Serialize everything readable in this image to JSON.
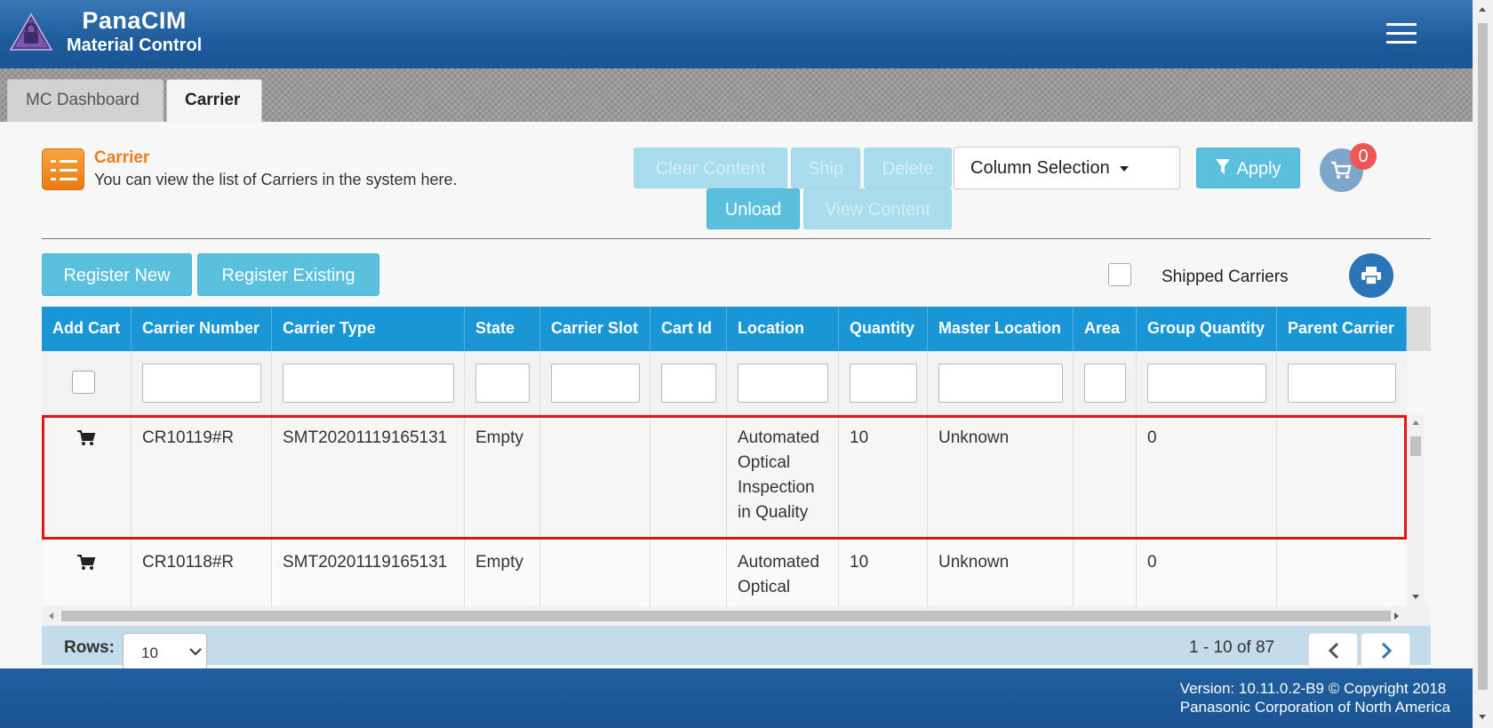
{
  "header": {
    "brand_line1": "PanaCIM",
    "brand_line2": "Material Control"
  },
  "tabs": [
    {
      "label": "MC Dashboard"
    },
    {
      "label": "Carrier"
    }
  ],
  "page": {
    "title": "Carrier",
    "description": "You can view the list of Carriers in the system here."
  },
  "toolbar": {
    "clear_content": "Clear Content",
    "ship": "Ship",
    "delete": "Delete",
    "unload": "Unload",
    "view_content": "View Content",
    "column_selection": "Column Selection",
    "apply": "Apply",
    "cart_count": "0"
  },
  "actions": {
    "register_new": "Register New",
    "register_existing": "Register Existing",
    "shipped_carriers": "Shipped Carriers"
  },
  "table": {
    "columns": [
      "Add Cart",
      "Carrier Number",
      "Carrier Type",
      "State",
      "Carrier Slot",
      "Cart Id",
      "Location",
      "Quantity",
      "Master Location",
      "Area",
      "Group Quantity",
      "Parent Carrier"
    ],
    "rows": [
      {
        "carrier_number": "CR10119#R",
        "carrier_type": "SMT20201119165131",
        "state": "Empty",
        "carrier_slot": "",
        "cart_id": "",
        "location": "Automated Optical Inspection in Quality",
        "quantity": "10",
        "master_location": "Unknown",
        "area": "",
        "group_quantity": "0",
        "parent_carrier": ""
      },
      {
        "carrier_number": "CR10118#R",
        "carrier_type": "SMT20201119165131",
        "state": "Empty",
        "carrier_slot": "",
        "cart_id": "",
        "location": "Automated Optical",
        "quantity": "10",
        "master_location": "Unknown",
        "area": "",
        "group_quantity": "0",
        "parent_carrier": ""
      }
    ]
  },
  "pager": {
    "rows_label": "Rows:",
    "rows_value": "10",
    "range": "1 - 10 of 87"
  },
  "footer": {
    "version_line1": "Version: 10.11.0.2-B9 © Copyright 2018",
    "version_line2": "Panasonic Corporation of North America"
  },
  "colors": {
    "header_blue": "#1d5b9b",
    "table_header": "#1a96d6",
    "button": "#5bc0de",
    "accent_orange": "#ee7f1d",
    "selection_outline": "#e01515",
    "badge": "#f05454"
  },
  "icons": [
    "lock-logo-icon",
    "hamburger-menu-icon",
    "list-icon",
    "filter-icon",
    "cart-icon",
    "print-icon",
    "chevron-left-icon",
    "chevron-right-icon"
  ]
}
